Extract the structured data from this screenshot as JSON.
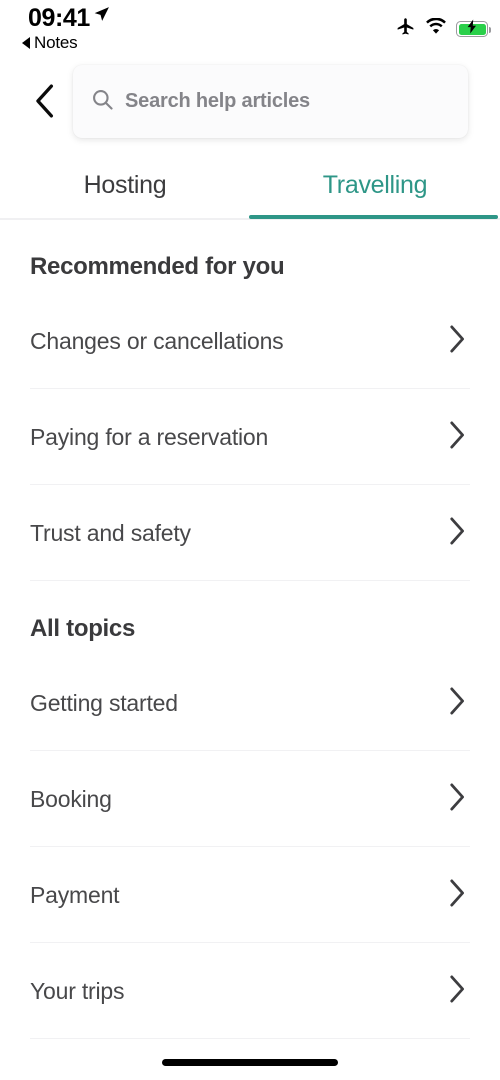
{
  "status_bar": {
    "time": "09:41",
    "location_icon": "location-arrow-icon",
    "back_app_label": "Notes",
    "back_app_icon": "triangle-left-icon",
    "airplane_icon": "airplane-mode-icon",
    "wifi_icon": "wifi-icon",
    "battery_icon": "battery-charging-icon",
    "battery_color": "#2ad04a"
  },
  "nav": {
    "back_icon": "chevron-left-icon"
  },
  "search": {
    "icon": "search-icon",
    "placeholder": "Search help articles",
    "value": ""
  },
  "tabs": {
    "items": [
      {
        "label": "Hosting",
        "active": false
      },
      {
        "label": "Travelling",
        "active": true
      }
    ],
    "active_color": "#2e9687",
    "inactive_color": "#3c3c3e"
  },
  "sections": [
    {
      "title": "Recommended for you",
      "items": [
        {
          "label": "Changes or cancellations",
          "chevron": "chevron-right-icon"
        },
        {
          "label": "Paying for a reservation",
          "chevron": "chevron-right-icon"
        },
        {
          "label": "Trust and safety",
          "chevron": "chevron-right-icon"
        }
      ]
    },
    {
      "title": "All topics",
      "items": [
        {
          "label": "Getting started",
          "chevron": "chevron-right-icon"
        },
        {
          "label": "Booking",
          "chevron": "chevron-right-icon"
        },
        {
          "label": "Payment",
          "chevron": "chevron-right-icon"
        },
        {
          "label": "Your trips",
          "chevron": "chevron-right-icon"
        }
      ]
    }
  ],
  "home_indicator": "home-indicator"
}
